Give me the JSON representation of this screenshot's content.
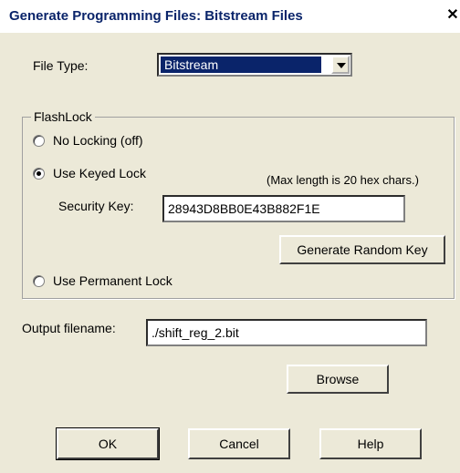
{
  "window": {
    "title": "Generate Programming Files: Bitstream Files",
    "close_glyph": "✕"
  },
  "file_type": {
    "label": "File Type:",
    "selected": "Bitstream"
  },
  "flashlock": {
    "legend": "FlashLock",
    "options": [
      {
        "label": "No Locking (off)",
        "selected": false
      },
      {
        "label": "Use Keyed Lock",
        "selected": true
      },
      {
        "label": "Use Permanent Lock",
        "selected": false
      }
    ],
    "max_length_note": "(Max length is 20 hex chars.)",
    "security_key_label": "Security Key:",
    "security_key_value": "28943D8BB0E43B882F1E",
    "generate_button": "Generate Random Key"
  },
  "output": {
    "label": "Output filename:",
    "value": "./shift_reg_2.bit",
    "browse_button": "Browse"
  },
  "footer": {
    "ok": "OK",
    "cancel": "Cancel",
    "help": "Help"
  },
  "colors": {
    "title_text": "#0a246a",
    "selection_bg": "#0a246a",
    "dialog_bg": "#ece9d8"
  }
}
